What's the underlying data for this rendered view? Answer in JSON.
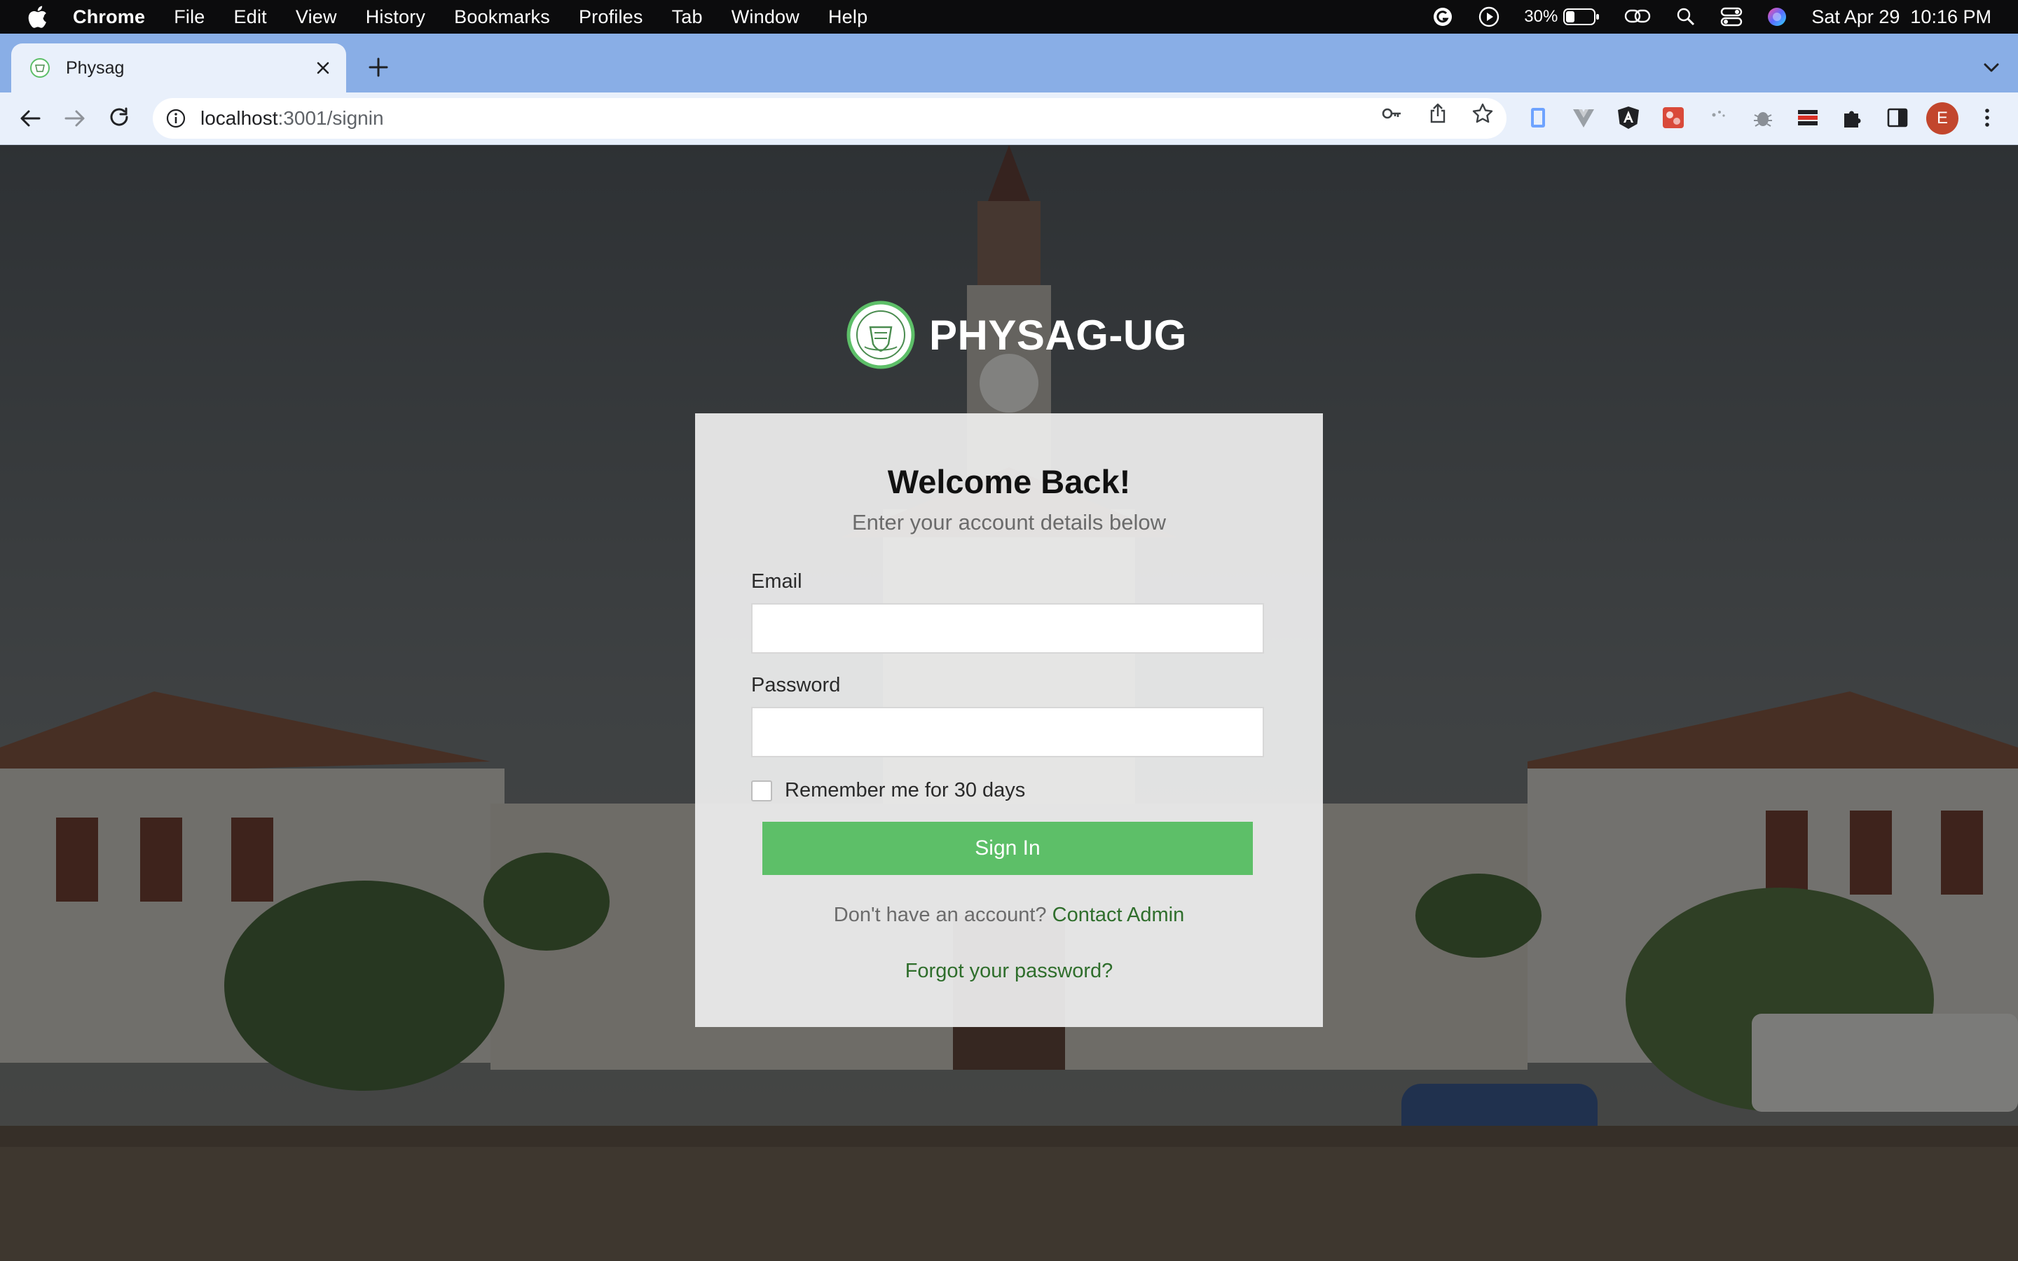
{
  "menubar": {
    "app_name": "Chrome",
    "items": [
      "File",
      "Edit",
      "View",
      "History",
      "Bookmarks",
      "Profiles",
      "Tab",
      "Window",
      "Help"
    ],
    "battery": "30%",
    "datetime": "Sat Apr 29  10:16 PM"
  },
  "browser": {
    "tab_title": "Physag",
    "url_host": "localhost",
    "url_path": ":3001/signin",
    "profile_initial": "E"
  },
  "page": {
    "brand_name": "PHYSAG-UG",
    "heading": "Welcome Back!",
    "subheading": "Enter your account details below",
    "email_label": "Email",
    "email_value": "",
    "password_label": "Password",
    "password_value": "",
    "remember_label": "Remember me for 30 days",
    "remember_checked": false,
    "signin_label": "Sign In",
    "no_account_text": "Don't have an account?",
    "contact_admin_label": "Contact Admin",
    "forgot_label": "Forgot your password?"
  },
  "colors": {
    "primary_button": "#5dbf68",
    "link": "#2f6e2c",
    "tabstrip": "#89aee6"
  }
}
